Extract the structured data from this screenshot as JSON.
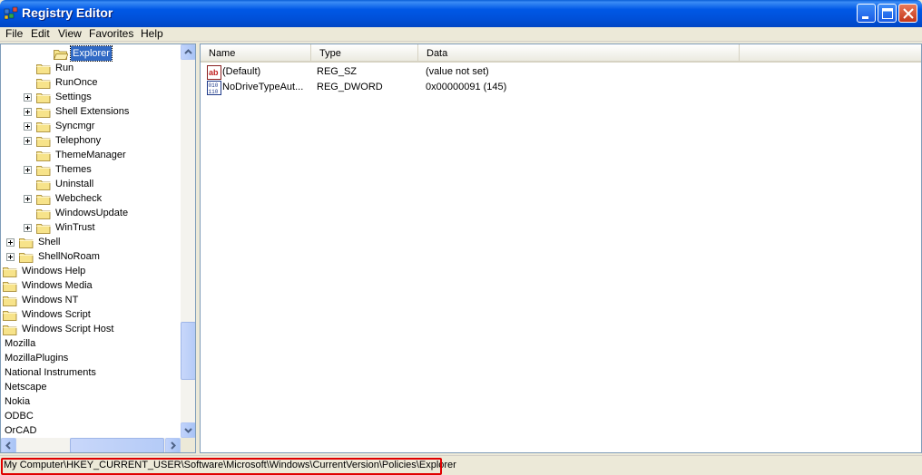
{
  "window": {
    "title": "Registry Editor"
  },
  "menu": [
    "File",
    "Edit",
    "View",
    "Favorites",
    "Help"
  ],
  "tree": [
    {
      "label": "Explorer",
      "depth": 3,
      "expandable": false,
      "selected": true,
      "open": true
    },
    {
      "label": "Run",
      "depth": 2,
      "expandable": false
    },
    {
      "label": "RunOnce",
      "depth": 2,
      "expandable": false
    },
    {
      "label": "Settings",
      "depth": 2,
      "expandable": true
    },
    {
      "label": "Shell Extensions",
      "depth": 2,
      "expandable": true
    },
    {
      "label": "Syncmgr",
      "depth": 2,
      "expandable": true
    },
    {
      "label": "Telephony",
      "depth": 2,
      "expandable": true
    },
    {
      "label": "ThemeManager",
      "depth": 2,
      "expandable": false
    },
    {
      "label": "Themes",
      "depth": 2,
      "expandable": true
    },
    {
      "label": "Uninstall",
      "depth": 2,
      "expandable": false
    },
    {
      "label": "Webcheck",
      "depth": 2,
      "expandable": true
    },
    {
      "label": "WindowsUpdate",
      "depth": 2,
      "expandable": false
    },
    {
      "label": "WinTrust",
      "depth": 2,
      "expandable": true
    },
    {
      "label": "Shell",
      "depth": 1,
      "expandable": true
    },
    {
      "label": "ShellNoRoam",
      "depth": 1,
      "expandable": true
    },
    {
      "label": "Windows Help",
      "depth": 0,
      "expandable": false
    },
    {
      "label": "Windows Media",
      "depth": 0,
      "expandable": false
    },
    {
      "label": "Windows NT",
      "depth": 0,
      "expandable": false
    },
    {
      "label": "Windows Script",
      "depth": 0,
      "expandable": false
    },
    {
      "label": "Windows Script Host",
      "depth": 0,
      "expandable": false
    },
    {
      "label": "Mozilla",
      "depth": -1,
      "expandable": false
    },
    {
      "label": "MozillaPlugins",
      "depth": -1,
      "expandable": false
    },
    {
      "label": "National Instruments",
      "depth": -1,
      "expandable": false
    },
    {
      "label": "Netscape",
      "depth": -1,
      "expandable": false
    },
    {
      "label": "Nokia",
      "depth": -1,
      "expandable": false
    },
    {
      "label": "ODBC",
      "depth": -1,
      "expandable": false
    },
    {
      "label": "OrCAD",
      "depth": -1,
      "expandable": false
    }
  ],
  "list": {
    "columns": [
      "Name",
      "Type",
      "Data"
    ],
    "rows": [
      {
        "icon": "string-value-icon",
        "name": "(Default)",
        "type": "REG_SZ",
        "data": "(value not set)"
      },
      {
        "icon": "binary-value-icon",
        "name": "NoDriveTypeAut...",
        "type": "REG_DWORD",
        "data": "0x00000091 (145)"
      }
    ]
  },
  "status": {
    "path": "My Computer\\HKEY_CURRENT_USER\\Software\\Microsoft\\Windows\\CurrentVersion\\Policies\\Explorer"
  },
  "colors": {
    "titlebar": "#0058e6",
    "selection": "#316ac5",
    "highlight_box": "#e00000"
  }
}
